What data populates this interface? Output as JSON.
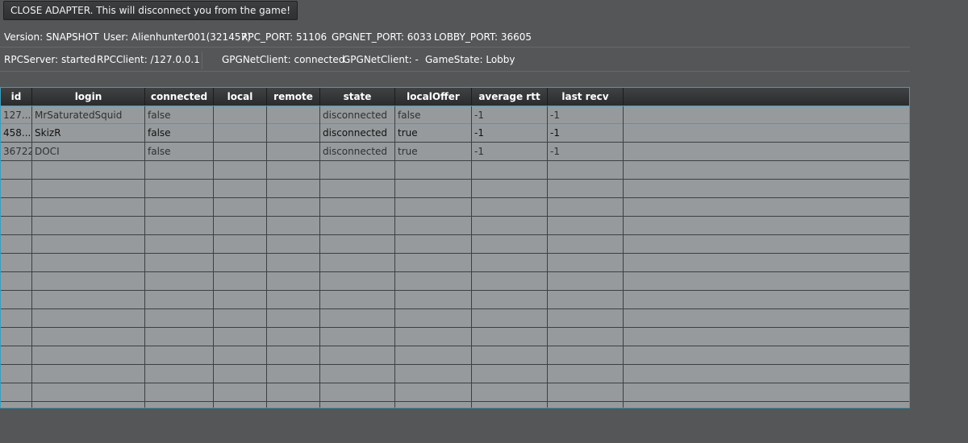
{
  "toolbar": {
    "close_label": "CLOSE ADAPTER. This will disconnect you from the game!"
  },
  "status_row1": {
    "version": "Version: SNAPSHOT",
    "user": "User: Alienhunter001(321457)",
    "rpc_port": "RPC_PORT: 51106",
    "gpgnet_port": "GPGNET_PORT: 6033",
    "lobby_port": "LOBBY_PORT: 36605"
  },
  "status_row2": {
    "rpc_server": "RPCServer: started",
    "rpc_client": "RPCClient: /127.0.0.1",
    "gpgnet_client_connected": "GPGNetClient: connected",
    "gpgnet_client_dash": "GPGNetClient: -",
    "game_state": "GameState: Lobby"
  },
  "table": {
    "headers": [
      "id",
      "login",
      "connected",
      "local",
      "remote",
      "state",
      "localOffer",
      "average rtt",
      "last recv"
    ],
    "rows": [
      [
        "127...",
        "MrSaturatedSquid",
        "false",
        "",
        "",
        "disconnected",
        "false",
        "-1",
        "-1"
      ],
      [
        "458...",
        "SkizR",
        "false",
        "",
        "",
        "disconnected",
        "true",
        "-1",
        "-1"
      ],
      [
        "36722",
        "DOCI",
        "false",
        "",
        "",
        "disconnected",
        "true",
        "-1",
        "-1"
      ]
    ]
  },
  "colors": {
    "background": "#545658",
    "table_body": "#979a9c",
    "accent": "#2fa3c7"
  }
}
